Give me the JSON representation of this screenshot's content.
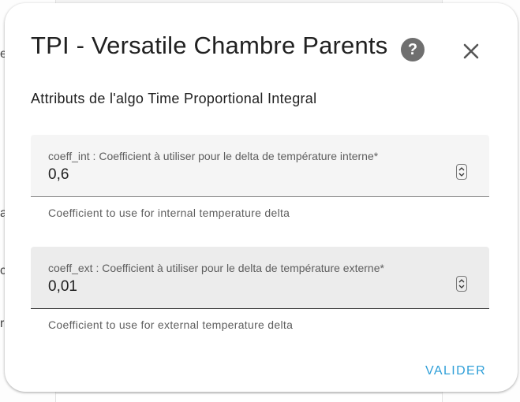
{
  "background": {
    "fragments": [
      "e",
      "a",
      "c",
      "r"
    ]
  },
  "dialog": {
    "title": "TPI - Versatile Chambre Parents",
    "help_icon": "help-circle-icon",
    "close_icon": "close-icon",
    "subtitle": "Attributs de l'algo Time Proportional Integral",
    "fields": [
      {
        "label": "coeff_int : Coefficient à utiliser pour le delta de température interne*",
        "value": "0,6",
        "helper": "Coefficient to use for internal temperature delta"
      },
      {
        "label": "coeff_ext : Coefficient à utiliser pour le delta de température externe*",
        "value": "0,01",
        "helper": "Coefficient to use for external temperature delta"
      }
    ],
    "submit_label": "VALIDER"
  },
  "colors": {
    "accent": "#2f9fd8",
    "field_bg": "#f5f5f5",
    "text": "#212121",
    "secondary_text": "#5e5e5e"
  }
}
